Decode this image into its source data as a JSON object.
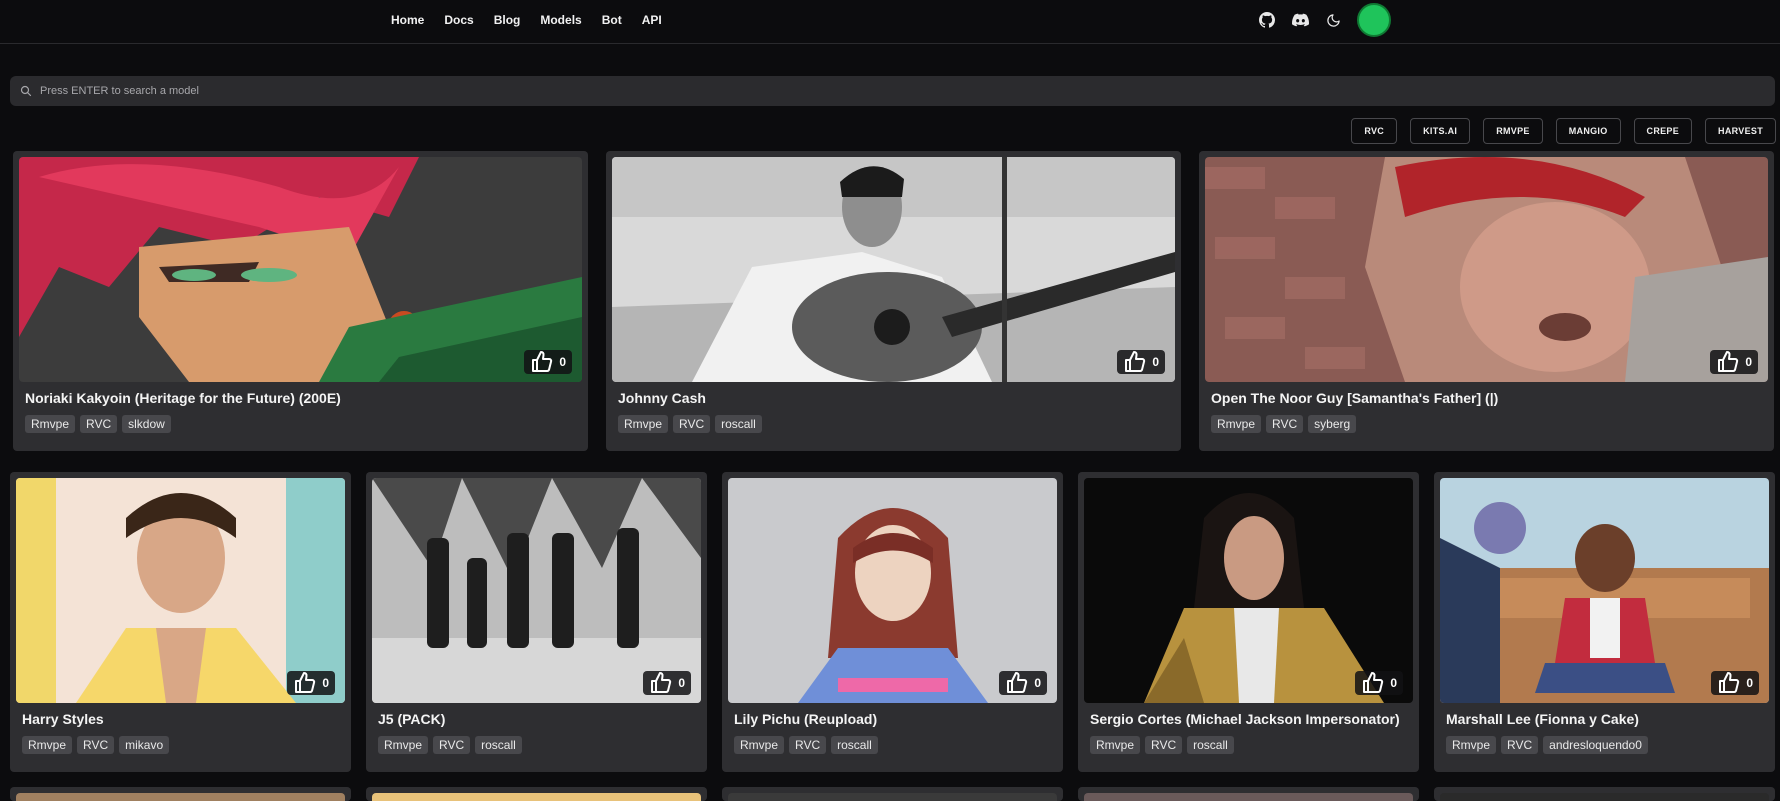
{
  "nav": {
    "items": [
      "Home",
      "Docs",
      "Blog",
      "Models",
      "Bot",
      "API"
    ]
  },
  "header_icons": [
    "github-icon",
    "discord-icon",
    "moon-icon"
  ],
  "search": {
    "placeholder": "Press ENTER to search a model"
  },
  "filters": [
    "RVC",
    "KITS.AI",
    "RMVPE",
    "MANGIO",
    "CREPE",
    "HARVEST"
  ],
  "colors": {
    "background": "#0c0c0e",
    "card": "#2e2e31",
    "tag": "#48484c",
    "avatar": "#1fc45b"
  },
  "cards": [
    {
      "title": "Noriaki Kakyoin (Heritage for the Future) (200E)",
      "likes": "0",
      "tags": [
        "Rmvpe",
        "RVC",
        "slkdow"
      ]
    },
    {
      "title": "Johnny Cash",
      "likes": "0",
      "tags": [
        "Rmvpe",
        "RVC",
        "roscall"
      ]
    },
    {
      "title": "Open The Noor Guy [Samantha's Father] (|)",
      "likes": "0",
      "tags": [
        "Rmvpe",
        "RVC",
        "syberg"
      ]
    },
    {
      "title": "Harry Styles",
      "likes": "0",
      "tags": [
        "Rmvpe",
        "RVC",
        "mikavo"
      ]
    },
    {
      "title": "J5 (PACK)",
      "likes": "0",
      "tags": [
        "Rmvpe",
        "RVC",
        "roscall"
      ]
    },
    {
      "title": "Lily Pichu (Reupload)",
      "likes": "0",
      "tags": [
        "Rmvpe",
        "RVC",
        "roscall"
      ]
    },
    {
      "title": "Sergio Cortes (Michael Jackson Impersonator)",
      "likes": "0",
      "tags": [
        "Rmvpe",
        "RVC",
        "roscall"
      ]
    },
    {
      "title": "Marshall Lee (Fionna y Cake)",
      "likes": "0",
      "tags": [
        "Rmvpe",
        "RVC",
        "andresloquendo0"
      ]
    }
  ]
}
